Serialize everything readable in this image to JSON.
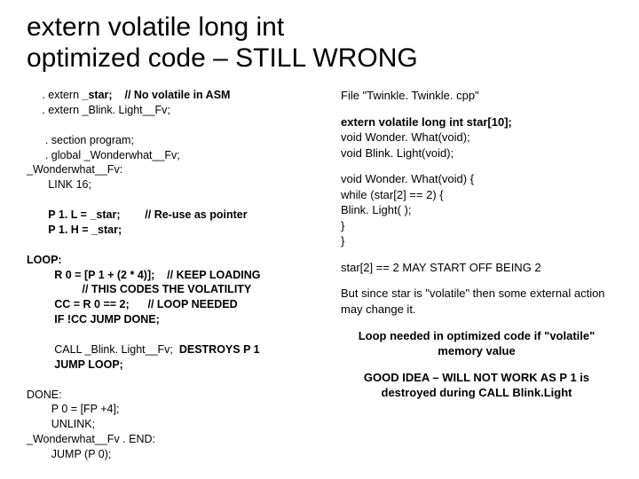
{
  "title": "extern volatile long int\noptimized code – STILL WRONG",
  "left": {
    "l1a": "     . extern ",
    "l1b": "_star;",
    "l1c": "    // No volatile in ASM",
    "l2": "     . extern _Blink. Light__Fv;",
    "blank1": " ",
    "l3": "      . section program;",
    "l4": "      . global _Wonderwhat__Fv;",
    "l5": "_Wonderwhat__Fv:",
    "l6": "       LINK 16;",
    "blank2": " ",
    "l7": "       P 1. L = _star;        // Re-use as pointer",
    "l8": "       P 1. H = _star;",
    "blank3": " ",
    "l9": "LOOP:",
    "l10": "         R 0 = [P 1 + (2 * 4)];    // KEEP LOADING",
    "l11": "                  // THIS CODES THE VOLATILITY",
    "l12": "         CC = R 0 == 2;      // LOOP NEEDED",
    "l13": "         IF !CC JUMP DONE;",
    "blank4": " ",
    "l14a": "         CALL _Blink. Light__Fv;  ",
    "l14b": "DESTROYS P 1",
    "l15": "         JUMP LOOP;",
    "blank5": " ",
    "l16": "DONE:",
    "l17": "        P 0 = [FP +4];",
    "l18": "        UNLINK;",
    "l19": "_Wonderwhat__Fv . END:",
    "l20": "        JUMP (P 0);"
  },
  "right": {
    "p1": "File \"Twinkle. Twinkle. cpp\"",
    "p2a": "extern volatile long int star[10];",
    "p2b": "void Wonder. What(void);",
    "p2c": "void Blink. Light(void);",
    "p3a": "void Wonder. What(void) {",
    "p3b": "   while (star[2] == 2) {",
    "p3c": "      Blink. Light( );",
    "p3d": "   }",
    "p3e": "}",
    "p4": "star[2] ==  2 MAY START OFF BEING 2",
    "p5": "But since star is \"volatile\" then some external action  may change it.",
    "p6": "Loop needed in optimized code if \"volatile\" memory value",
    "p7": "GOOD IDEA – WILL NOT WORK AS P 1 is destroyed during CALL Blink.Light"
  }
}
